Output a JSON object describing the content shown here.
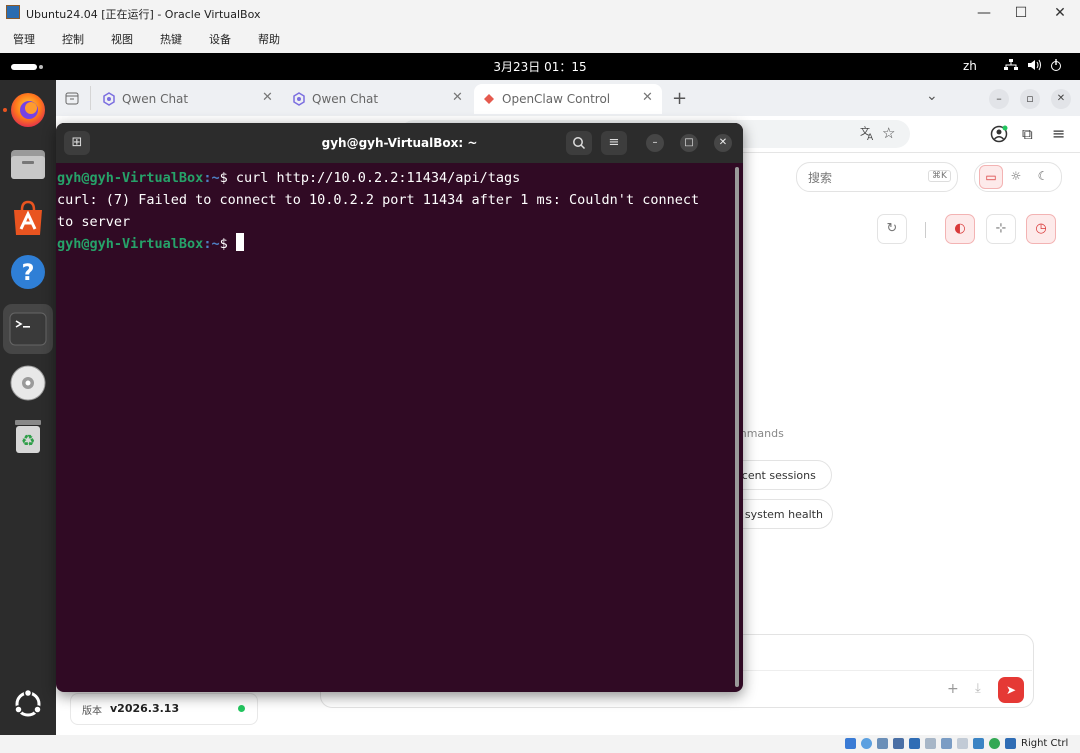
{
  "host_window": {
    "title": "Ubuntu24.04 [正在运行] - Oracle VirtualBox",
    "controls": {
      "minimize": "—",
      "maximize": "☐",
      "close": "✕"
    },
    "menu": [
      "管理",
      "控制",
      "视图",
      "热键",
      "设备",
      "帮助"
    ]
  },
  "topbar": {
    "clock": "3月23日 01：15",
    "input_method": "zh",
    "tray_icons": [
      "network-icon",
      "volume-icon",
      "power-icon"
    ]
  },
  "dock": {
    "apps": [
      "firefox",
      "files",
      "app-center",
      "help",
      "terminal",
      "optical-drive",
      "trash"
    ],
    "show_apps_icon": "ubuntu-logo"
  },
  "browser": {
    "tabs": [
      {
        "label": "Qwen Chat",
        "active": false
      },
      {
        "label": "Qwen Chat",
        "active": false
      },
      {
        "label": "OpenClaw Control",
        "active": true
      }
    ],
    "new_tab": "+",
    "dropdown": "⌄",
    "window_controls": {
      "minimize": "–",
      "restore": "▫",
      "close": "✕"
    }
  },
  "openclaw": {
    "search_placeholder": "搜索",
    "search_shortcut": "⌘K",
    "commands_heading_partial": "mmands",
    "chips": [
      "ecent sessions",
      "k system health"
    ],
    "version_label": "版本",
    "version_value": "v2026.3.13",
    "accent_color": "#e53935"
  },
  "terminal": {
    "title": "gyh@gyh-VirtualBox: ~",
    "user_host": "gyh@gyh-VirtualBox",
    "path": ":~",
    "command": "$ curl http://10.0.2.2:11434/api/tags",
    "output_line1": "curl: (7) Failed to connect to 10.0.2.2 port 11434 after 1 ms: Couldn't connect",
    "output_line2": "to server",
    "prompt_end": "$ "
  },
  "statusbar": {
    "host_key": "Right Ctrl"
  }
}
